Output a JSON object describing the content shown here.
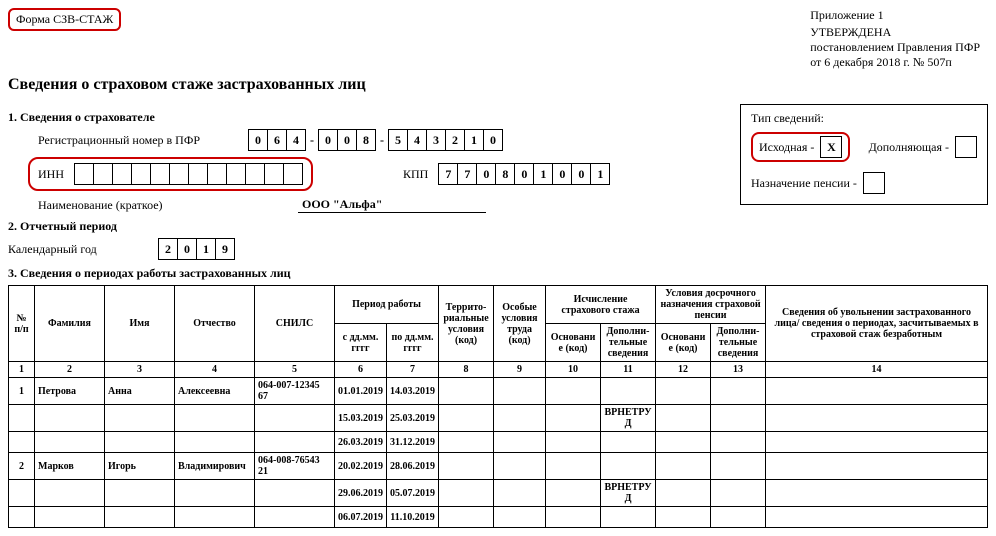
{
  "form_badge": "Форма СЗВ-СТАЖ",
  "appendix": {
    "line1": "Приложение 1",
    "line2": "УТВЕРЖДЕНА",
    "line3": "постановлением Правления ПФР",
    "line4": "от 6 декабря 2018 г. № 507п"
  },
  "title": "Сведения о страховом стаже застрахованных лиц",
  "section1": {
    "head": "1. Сведения о страхователе",
    "reg_label": "Регистрационный номер в ПФР",
    "reg": {
      "g1": [
        "0",
        "6",
        "4"
      ],
      "g2": [
        "0",
        "0",
        "8"
      ],
      "g3": [
        "5",
        "4",
        "3",
        "2",
        "1",
        "0"
      ]
    },
    "inn_label": "ИНН",
    "inn": [
      "",
      "",
      "",
      "",
      "",
      "",
      "",
      "",
      "",
      "",
      "",
      ""
    ],
    "kpp_label": "КПП",
    "kpp": [
      "7",
      "7",
      "0",
      "8",
      "0",
      "1",
      "0",
      "0",
      "1"
    ],
    "name_label": "Наименование (краткое)",
    "name_value": "ООО \"Альфа\""
  },
  "type_box": {
    "head": "Тип сведений:",
    "initial_label": "Исходная -",
    "initial_mark": "X",
    "suppl_label": "Дополняющая -",
    "suppl_mark": "",
    "pension_label": "Назначение пенсии -",
    "pension_mark": ""
  },
  "section2": {
    "head": "2. Отчетный период",
    "year_label": "Календарный год",
    "year": [
      "2",
      "0",
      "1",
      "9"
    ]
  },
  "section3": {
    "head": "3. Сведения о периодах работы застрахованных лиц",
    "headers": {
      "num": "№ п/п",
      "fam": "Фамилия",
      "name": "Имя",
      "patr": "Отчество",
      "snils": "СНИЛС",
      "period": "Период работы",
      "from": "с дд.мм. гггг",
      "to": "по дд.мм. гггг",
      "terr": "Террито- риальные условия (код)",
      "cond": "Особые условия труда (код)",
      "stazh": "Исчисление страхового стажа",
      "early": "Условия досрочного назначения страховой пенсии",
      "base": "Основание (код)",
      "extra": "Дополни- тельные сведения",
      "dismiss": "Сведения об увольнении застрахованного лица/ сведения о периодах, засчитываемых в страховой стаж безработным"
    },
    "colnums": [
      "1",
      "2",
      "3",
      "4",
      "5",
      "6",
      "7",
      "8",
      "9",
      "10",
      "11",
      "12",
      "13",
      "14"
    ],
    "rows": [
      {
        "n": "1",
        "f": "Петрова",
        "i": "Анна",
        "o": "Алексеевна",
        "s": "064-007-12345 67",
        "d1": "01.01.2019",
        "d2": "14.03.2019",
        "t": "",
        "c": "",
        "b1": "",
        "e1": "",
        "b2": "",
        "e2": "",
        "x": ""
      },
      {
        "n": "",
        "f": "",
        "i": "",
        "o": "",
        "s": "",
        "d1": "15.03.2019",
        "d2": "25.03.2019",
        "t": "",
        "c": "",
        "b1": "",
        "e1": "ВРНЕТРУД",
        "b2": "",
        "e2": "",
        "x": ""
      },
      {
        "n": "",
        "f": "",
        "i": "",
        "o": "",
        "s": "",
        "d1": "26.03.2019",
        "d2": "31.12.2019",
        "t": "",
        "c": "",
        "b1": "",
        "e1": "",
        "b2": "",
        "e2": "",
        "x": ""
      },
      {
        "n": "2",
        "f": "Марков",
        "i": "Игорь",
        "o": "Владимирович",
        "s": "064-008-76543 21",
        "d1": "20.02.2019",
        "d2": "28.06.2019",
        "t": "",
        "c": "",
        "b1": "",
        "e1": "",
        "b2": "",
        "e2": "",
        "x": ""
      },
      {
        "n": "",
        "f": "",
        "i": "",
        "o": "",
        "s": "",
        "d1": "29.06.2019",
        "d2": "05.07.2019",
        "t": "",
        "c": "",
        "b1": "",
        "e1": "ВРНЕТРУД",
        "b2": "",
        "e2": "",
        "x": ""
      },
      {
        "n": "",
        "f": "",
        "i": "",
        "o": "",
        "s": "",
        "d1": "06.07.2019",
        "d2": "11.10.2019",
        "t": "",
        "c": "",
        "b1": "",
        "e1": "",
        "b2": "",
        "e2": "",
        "x": ""
      }
    ]
  }
}
